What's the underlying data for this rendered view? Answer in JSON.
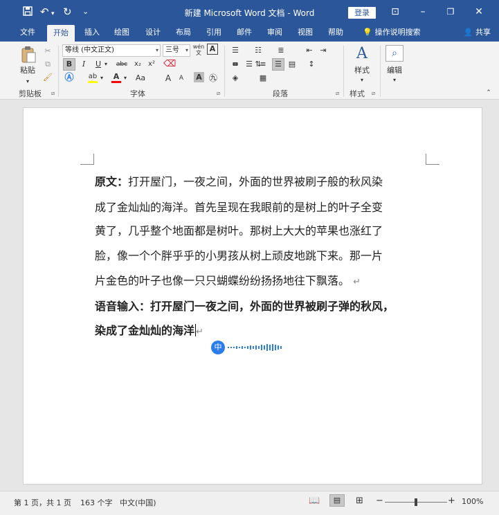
{
  "window": {
    "title": "新建 Microsoft Word 文档  -  Word",
    "login_label": "登录",
    "minimize_glyph": "–",
    "restore_glyph": "❐",
    "close_glyph": "✕",
    "ribbon_display_glyph": "⊡"
  },
  "quick_access": {
    "save_icon": "💾",
    "undo_icon": "↶",
    "redo_icon": "↻",
    "customize_icon": "⌄"
  },
  "tabs": [
    "文件",
    "开始",
    "插入",
    "绘图",
    "设计",
    "布局",
    "引用",
    "邮件",
    "审阅",
    "视图",
    "帮助"
  ],
  "active_tab": "开始",
  "tell_me": "操作说明搜索",
  "share": "共享",
  "ribbon": {
    "clipboard": {
      "paste": "粘贴",
      "group": "剪贴板"
    },
    "font": {
      "font_name": "等线 (中文正文)",
      "font_size": "三号",
      "phonetic": "wén",
      "bold": "B",
      "italic": "I",
      "underline": "U",
      "strike": "abc",
      "subscript": "x₂",
      "superscript": "x²",
      "grow": "A",
      "shrink": "A",
      "case": "Aa",
      "group": "字体"
    },
    "paragraph": {
      "group": "段落"
    },
    "styles": {
      "label": "样式",
      "group": "样式"
    },
    "editing": {
      "label": "编辑"
    }
  },
  "document": {
    "lines": [
      {
        "bold_prefix": "原文：",
        "text": "打开屋门，一夜之间，外面的世界被刷子般的秋风染"
      },
      {
        "bold_prefix": "",
        "text": "成了金灿灿的海洋。首先呈现在我眼前的是树上的叶子全变"
      },
      {
        "bold_prefix": "",
        "text": "黄了，几乎整个地面都是树叶。那树上大大的苹果也涨红了"
      },
      {
        "bold_prefix": "",
        "text": "脸，像一个个胖乎乎的小男孩从树上顽皮地跳下来。那一片"
      },
      {
        "bold_prefix": "",
        "text": "片金色的叶子也像一只只蝴蝶纷纷扬扬地往下飘落。"
      }
    ],
    "voice_lines": [
      {
        "bold_prefix": "语音输入：",
        "text": "打开屋门一夜之间，外面的世界被刷子弹的秋风，"
      },
      {
        "bold_prefix": "",
        "text": "染成了金灿灿的海洋"
      }
    ],
    "paragraph_mark": "↵",
    "ime_indicator": "中"
  },
  "status_bar": {
    "page": "第 1 页，共 1 页",
    "words": "163 个字",
    "language": "中文(中国)",
    "zoom": "100%",
    "zoom_minus": "−",
    "zoom_plus": "+",
    "zoom_level": 0.5
  },
  "colors": {
    "brand": "#2b579a",
    "ime_blue": "#2b7de9",
    "highlight": "#ffff00",
    "font_color": "#ff0000"
  }
}
